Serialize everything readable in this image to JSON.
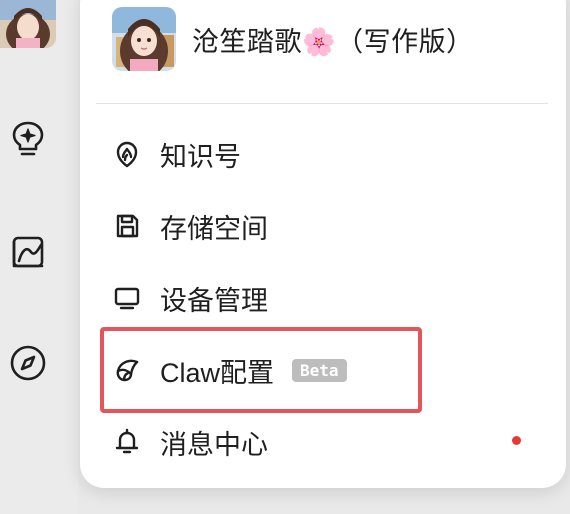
{
  "sidebar": {
    "avatar": "user-avatar",
    "icons": [
      "lightbulb-sparkle-icon",
      "chart-line-icon",
      "compass-icon"
    ]
  },
  "profile": {
    "name": "沧笙踏歌🌸（写作版）"
  },
  "menu": {
    "items": [
      {
        "label": "知识号",
        "icon": "knowledge-icon"
      },
      {
        "label": "存储空间",
        "icon": "storage-icon"
      },
      {
        "label": "设备管理",
        "icon": "monitor-icon"
      },
      {
        "label": "Claw配置",
        "icon": "claw-icon",
        "badge": "Beta"
      },
      {
        "label": "消息中心",
        "icon": "bell-icon",
        "has_unread_dot": true
      }
    ]
  },
  "colors": {
    "highlight": "#e5535b",
    "badge_bg": "#bdbdbd",
    "unread_dot": "#e53935"
  }
}
